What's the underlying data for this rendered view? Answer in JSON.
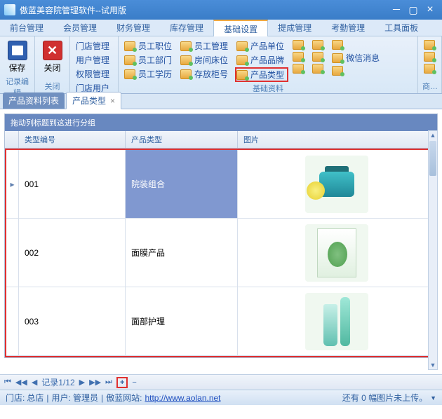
{
  "window": {
    "title": "傲蓝美容院管理软件--试用版"
  },
  "menus": [
    "前台管理",
    "会员管理",
    "财务管理",
    "库存管理",
    "基础设置",
    "提成管理",
    "考勤管理",
    "工具面板"
  ],
  "active_menu_index": 4,
  "ribbon": {
    "group1": {
      "save": "保存",
      "close": "关闭",
      "label1": "记录编辑",
      "label2": "关闭"
    },
    "group2": {
      "items": [
        "门店管理",
        "用户管理",
        "权限管理",
        "门店用户"
      ]
    },
    "group3": {
      "rows": [
        [
          "员工职位",
          "员工管理",
          "产品单位"
        ],
        [
          "员工部门",
          "房间床位",
          "产品品牌",
          "",
          "微信消息"
        ],
        [
          "员工学历",
          "存放柜号",
          "产品类型"
        ]
      ],
      "label": "基础资料",
      "highlighted": "产品类型"
    },
    "group4": {
      "label": "商…"
    }
  },
  "tabs": [
    {
      "label": "产品资料列表",
      "active": false
    },
    {
      "label": "产品类型",
      "active": true,
      "closable": true
    }
  ],
  "grid": {
    "group_hint": "拖动列标题到这进行分组",
    "columns": [
      "类型编号",
      "产品类型",
      "图片"
    ],
    "rows": [
      {
        "code": "001",
        "type": "院装组合",
        "selected": true,
        "img": "jar"
      },
      {
        "code": "002",
        "type": "面膜产品",
        "selected": false,
        "img": "mask"
      },
      {
        "code": "003",
        "type": "面部护理",
        "selected": false,
        "img": "tubes"
      }
    ]
  },
  "nav": {
    "record_text": "记录1/12",
    "plus": "+",
    "minus": "−"
  },
  "status": {
    "store_label": "门店:",
    "store": "总店",
    "user_label": "用户:",
    "user": "管理员",
    "site_label": "傲蓝网站:",
    "site_url": "http://www.aolan.net",
    "right": "还有 0 幅图片未上传。"
  }
}
